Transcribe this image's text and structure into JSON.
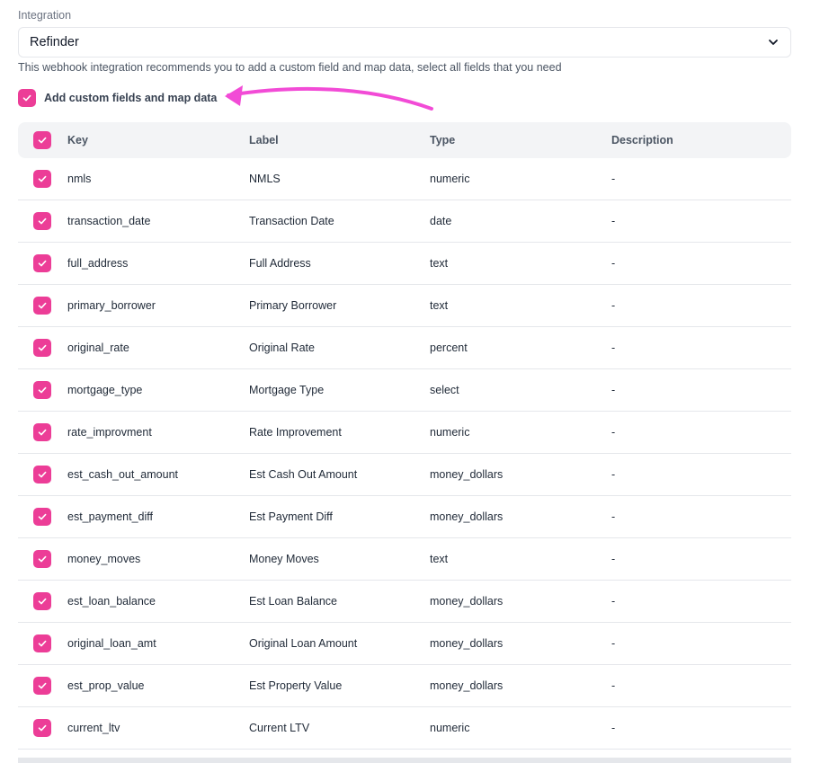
{
  "integration": {
    "label": "Integration",
    "selected": "Refinder",
    "chevron_icon": "chevron-down-icon"
  },
  "helper_text": "This webhook integration recommends you to add a custom field and map data, select all fields that you need",
  "custom_fields": {
    "checked": true,
    "label": "Add custom fields and map data"
  },
  "annotation": {
    "color": "#f24bd6"
  },
  "colors": {
    "accent": "#ec3d97",
    "header_bg": "#f3f4f6"
  },
  "table": {
    "headers": {
      "key": "Key",
      "label": "Label",
      "type": "Type",
      "description": "Description"
    },
    "rows": [
      {
        "checked": true,
        "key": "nmls",
        "label": "NMLS",
        "type": "numeric",
        "description": "-"
      },
      {
        "checked": true,
        "key": "transaction_date",
        "label": "Transaction Date",
        "type": "date",
        "description": "-"
      },
      {
        "checked": true,
        "key": "full_address",
        "label": "Full Address",
        "type": "text",
        "description": "-"
      },
      {
        "checked": true,
        "key": "primary_borrower",
        "label": "Primary Borrower",
        "type": "text",
        "description": "-"
      },
      {
        "checked": true,
        "key": "original_rate",
        "label": "Original Rate",
        "type": "percent",
        "description": "-"
      },
      {
        "checked": true,
        "key": "mortgage_type",
        "label": "Mortgage Type",
        "type": "select",
        "description": "-"
      },
      {
        "checked": true,
        "key": "rate_improvment",
        "label": "Rate Improvement",
        "type": "numeric",
        "description": "-"
      },
      {
        "checked": true,
        "key": "est_cash_out_amount",
        "label": "Est Cash Out Amount",
        "type": "money_dollars",
        "description": "-"
      },
      {
        "checked": true,
        "key": "est_payment_diff",
        "label": "Est Payment Diff",
        "type": "money_dollars",
        "description": "-"
      },
      {
        "checked": true,
        "key": "money_moves",
        "label": "Money Moves",
        "type": "text",
        "description": "-"
      },
      {
        "checked": true,
        "key": "est_loan_balance",
        "label": "Est Loan Balance",
        "type": "money_dollars",
        "description": "-"
      },
      {
        "checked": true,
        "key": "original_loan_amt",
        "label": "Original Loan Amount",
        "type": "money_dollars",
        "description": "-"
      },
      {
        "checked": true,
        "key": "est_prop_value",
        "label": "Est Property Value",
        "type": "money_dollars",
        "description": "-"
      },
      {
        "checked": true,
        "key": "current_ltv",
        "label": "Current LTV",
        "type": "numeric",
        "description": "-"
      }
    ]
  }
}
